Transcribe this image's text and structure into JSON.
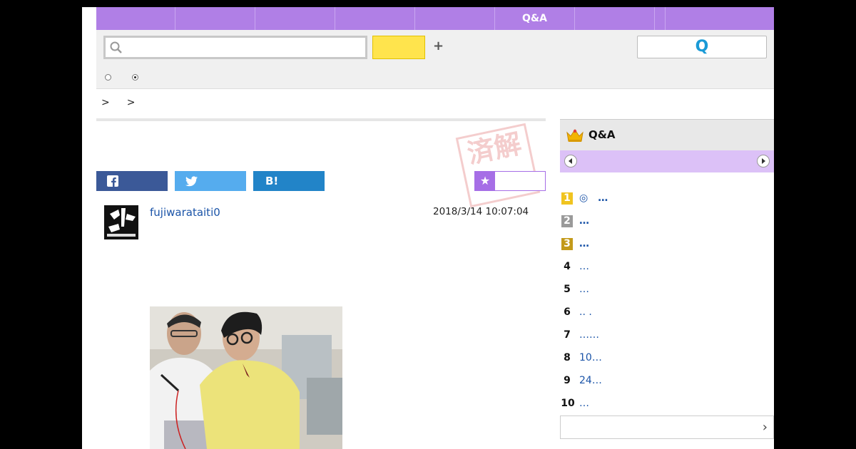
{
  "nav": {
    "items": [
      {
        "label": ""
      },
      {
        "label": ""
      },
      {
        "label": ""
      },
      {
        "label": ""
      },
      {
        "label": ""
      },
      {
        "label": "Q&A"
      },
      {
        "label": ""
      },
      {
        "label": ""
      },
      {
        "label": ""
      }
    ]
  },
  "search": {
    "placeholder": "",
    "button_label": "",
    "plus_label": "+",
    "q_button_label": "Q"
  },
  "breadcrumb": {
    "sep1": ">",
    "sep2": ">"
  },
  "stamp_text": "済解",
  "question": {
    "username": "fujiwarataiti0",
    "date": "2018/3/14  10:07:04"
  },
  "share": {
    "twitter_label": "",
    "hatena_label": "B!"
  },
  "sidebar": {
    "title": "Q&A",
    "ranking": [
      {
        "rank": "1",
        "text": "◎　…"
      },
      {
        "rank": "2",
        "text": "…"
      },
      {
        "rank": "3",
        "text": "…"
      },
      {
        "rank": "4",
        "text": "…"
      },
      {
        "rank": "5",
        "text": "…"
      },
      {
        "rank": "6",
        "text": " ..  ."
      },
      {
        "rank": "7",
        "text": "……"
      },
      {
        "rank": "8",
        "text": "10…"
      },
      {
        "rank": "9",
        "text": "24…"
      },
      {
        "rank": "10",
        "text": "   …"
      }
    ],
    "more_label": "›"
  },
  "colors": {
    "nav": "#b07fe6",
    "accent_yellow": "#ffe44d",
    "link": "#1b54a8",
    "facebook": "#3b5998",
    "twitter": "#55acee",
    "hatena": "#2284c8"
  }
}
